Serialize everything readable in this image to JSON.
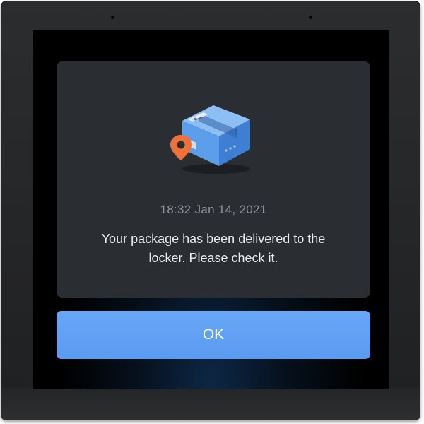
{
  "notification": {
    "timestamp": "18:32 Jan 14, 2021",
    "message": "Your package has been delivered to the locker. Please check it.",
    "ok_label": "OK",
    "icon": "package-delivered-icon"
  },
  "colors": {
    "card_background": "#2a2d31",
    "button_background": "#5b9bf0",
    "pin": "#f0703a",
    "box": "#4d8ee0"
  }
}
